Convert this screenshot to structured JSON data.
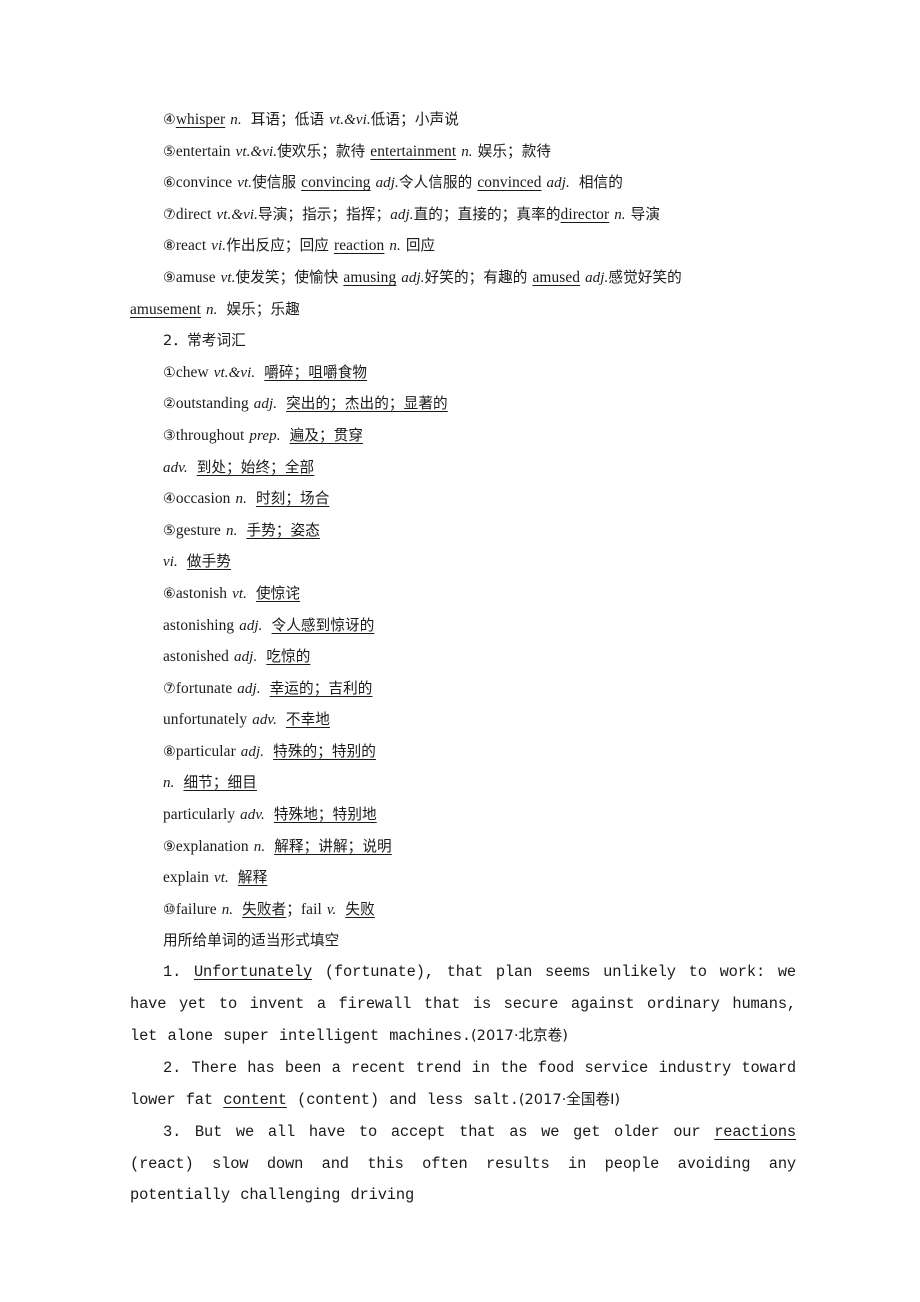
{
  "document": {
    "type": "chinese-english-vocabulary-worksheet",
    "page_background": "#ffffff",
    "text_color": "#1a1a1a"
  },
  "section_core": {
    "entries": [
      {
        "marker": "④",
        "headword": "whisper",
        "headword_underlined": true,
        "body": [
          {
            "t": "n.",
            "style": "pos"
          },
          {
            "t": "耳语；低语",
            "style": "cn"
          },
          {
            "t": "vt.&vi.",
            "style": "pos"
          },
          {
            "t": "低语；小声说",
            "style": "cn"
          }
        ]
      },
      {
        "marker": "⑤",
        "headword": "entertain",
        "headword_underlined": false,
        "body": [
          {
            "t": "vt.&vi.",
            "style": "pos"
          },
          {
            "t": "使欢乐；款待",
            "style": "cn"
          },
          {
            "t": "entertainment",
            "style": "en-u"
          },
          {
            "t": "n.",
            "style": "pos"
          },
          {
            "t": "娱乐；款待",
            "style": "cn"
          }
        ]
      },
      {
        "marker": "⑥",
        "headword": "convince",
        "headword_underlined": false,
        "body": [
          {
            "t": "vt.",
            "style": "pos"
          },
          {
            "t": "使信服",
            "style": "cn"
          },
          {
            "t": "convincing",
            "style": "en-u"
          },
          {
            "t": "adj.",
            "style": "pos"
          },
          {
            "t": "令人信服的",
            "style": "cn"
          },
          {
            "t": "convinced",
            "style": "en-u"
          },
          {
            "t": "adj.",
            "style": "pos"
          },
          {
            "t": "相信的",
            "style": "cn"
          }
        ]
      },
      {
        "marker": "⑦",
        "headword": "direct",
        "headword_underlined": false,
        "body": [
          {
            "t": "vt.&vi.",
            "style": "pos"
          },
          {
            "t": "导演；指示；指挥；",
            "style": "cn"
          },
          {
            "t": "adj.",
            "style": "pos"
          },
          {
            "t": "直的；直接的；真率的",
            "style": "cn"
          },
          {
            "t": "director",
            "style": "en-u"
          },
          {
            "t": "n.",
            "style": "pos"
          },
          {
            "t": "导演",
            "style": "cn"
          }
        ]
      },
      {
        "marker": "⑧",
        "headword": "react",
        "headword_underlined": false,
        "body": [
          {
            "t": "vi.",
            "style": "pos"
          },
          {
            "t": "作出反应；回应",
            "style": "cn"
          },
          {
            "t": "reaction",
            "style": "en-u"
          },
          {
            "t": "n.",
            "style": "pos"
          },
          {
            "t": "回应",
            "style": "cn"
          }
        ]
      },
      {
        "marker": "⑨",
        "headword": "amuse",
        "headword_underlined": false,
        "body": [
          {
            "t": "vt.",
            "style": "pos"
          },
          {
            "t": "使发笑；使愉快",
            "style": "cn"
          },
          {
            "t": "amusing",
            "style": "en-u"
          },
          {
            "t": "adj.",
            "style": "pos"
          },
          {
            "t": "好笑的；有趣的",
            "style": "cn"
          },
          {
            "t": "amused",
            "style": "en-u"
          },
          {
            "t": "adj.",
            "style": "pos"
          },
          {
            "t": "感觉好笑的",
            "style": "cn"
          }
        ]
      }
    ],
    "wrap_line": {
      "headword": "amusement",
      "headword_underlined": true,
      "body": [
        {
          "t": "n.",
          "style": "pos"
        },
        {
          "t": "娱乐；乐趣",
          "style": "cn"
        }
      ]
    }
  },
  "section2": {
    "heading": "2．常考词汇",
    "entries": [
      {
        "marker": "①",
        "headword": "chew",
        "pos": "vt.&vi.",
        "meaning": "嚼碎；咀嚼食物",
        "indent": true
      },
      {
        "marker": "②",
        "headword": "outstanding",
        "pos": "adj.",
        "meaning": "突出的；杰出的；显著的",
        "indent": true
      },
      {
        "marker": "③",
        "headword": "throughout",
        "pos": "prep.",
        "meaning": "遍及；贯穿",
        "indent": true
      },
      {
        "marker": "",
        "headword": "",
        "pos": "adv.",
        "meaning": "到处；始终；全部",
        "indent": true
      },
      {
        "marker": "④",
        "headword": "occasion",
        "pos": "n.",
        "meaning": "时刻；场合",
        "indent": true
      },
      {
        "marker": "⑤",
        "headword": "gesture",
        "pos": "n.",
        "meaning": "手势；姿态",
        "indent": true
      },
      {
        "marker": "",
        "headword": "",
        "pos": "vi.",
        "meaning": "做手势",
        "indent": true
      },
      {
        "marker": "⑥",
        "headword": "astonish",
        "pos": "vt.",
        "meaning": "使惊诧",
        "indent": true
      },
      {
        "marker": "",
        "headword": "astonishing",
        "pos": "adj.",
        "meaning": "令人感到惊讶的",
        "indent": true
      },
      {
        "marker": "",
        "headword": "astonished",
        "pos": "adj.",
        "meaning": "吃惊的",
        "indent": true
      },
      {
        "marker": "⑦",
        "headword": "fortunate",
        "pos": "adj.",
        "meaning": "幸运的；吉利的",
        "indent": true
      },
      {
        "marker": "",
        "headword": "unfortunately",
        "pos": "adv.",
        "meaning": "不幸地",
        "indent": true
      },
      {
        "marker": "⑧",
        "headword": "particular",
        "pos": "adj.",
        "meaning": "特殊的；特别的",
        "indent": true
      },
      {
        "marker": "",
        "headword": "",
        "pos": "n.",
        "meaning": "细节；细目",
        "indent": true
      },
      {
        "marker": "",
        "headword": "particularly",
        "pos": "adv.",
        "meaning": "特殊地；特别地",
        "indent": true
      },
      {
        "marker": "⑨",
        "headword": "explanation",
        "pos": "n.",
        "meaning": "解释；讲解；说明",
        "indent": true
      },
      {
        "marker": "",
        "headword": "explain",
        "pos": "vt.",
        "meaning": "解释",
        "indent": true
      }
    ],
    "entry10": {
      "marker": "⑩",
      "headword": "failure",
      "pos": "n.",
      "meaning": "失败者",
      "sep": "；",
      "headword2": "fail",
      "pos2": "v.",
      "meaning2": "失败"
    }
  },
  "exercise": {
    "instruction": "用所给单词的适当形式填空",
    "items": [
      {
        "number": "1.",
        "answer": "Unfortunately",
        "rest_before": "",
        "text": " (fortunate), that plan seems unlikely to work: we have yet to invent a firewall that is secure against ordinary humans, let alone super intelligent machines.",
        "source": "(2017·北京卷)"
      },
      {
        "number": "2.",
        "lead": "There has been a recent trend in the food service industry toward lower fat ",
        "answer": "content",
        "text": " (content) and less salt.",
        "source": "(2017·全国卷Ⅰ)"
      },
      {
        "number": "3.",
        "lead": "But we all have to accept that as we get older our ",
        "answer": "reactions",
        "text": " (react) slow down and this often results in people avoiding any potentially challenging driving",
        "source": ""
      }
    ]
  }
}
